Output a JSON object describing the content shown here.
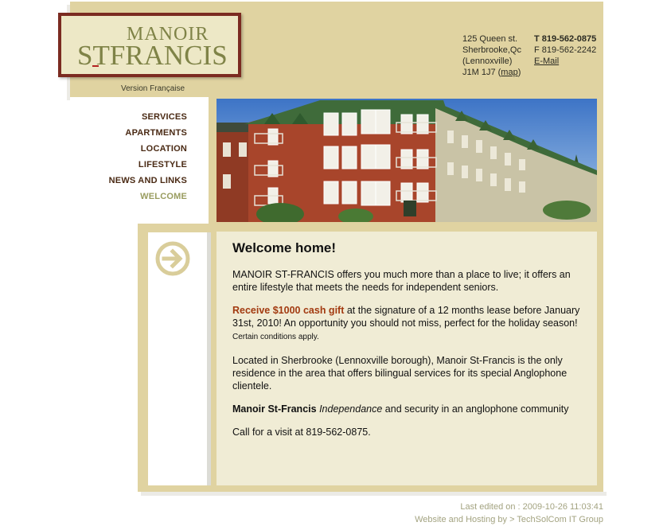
{
  "brand": {
    "logo_line1": "MANOIR",
    "logo_line2": "STFRANCIS",
    "language_link": "Version Française"
  },
  "contact": {
    "address_line1": "125 Queen st.",
    "address_line2": "Sherbrooke,Qc",
    "address_line3": "(Lennoxville)",
    "address_line4_prefix": "J1M 1J7 (",
    "map_link": "map",
    "address_line4_suffix": ")",
    "phone": "T 819-562-0875",
    "fax": "F 819-562-2242",
    "email_link": "E-Mail"
  },
  "nav": {
    "items": [
      {
        "label": "SERVICES"
      },
      {
        "label": "APARTMENTS"
      },
      {
        "label": "LOCATION"
      },
      {
        "label": "LIFESTYLE"
      },
      {
        "label": "NEWS AND LINKS"
      },
      {
        "label": "WELCOME"
      }
    ],
    "active_color": "#999c5f"
  },
  "icons": {
    "side": "arrow-circle-right-icon"
  },
  "content": {
    "title": "Welcome home!",
    "p1": "MANOIR ST-FRANCIS offers you much more than a place to live; it offers an entire lifestyle that meets the needs for independent seniors.",
    "promo_highlight": "Receive $1000 cash gift",
    "promo_rest": " at the signature of a 12 months lease before January 31st, 2010! An opportunity you should not miss, perfect for the holiday season! ",
    "promo_note": "Certain conditions apply.",
    "p3": "Located in Sherbrooke (Lennoxville borough), Manoir St-Francis is the only residence in the area that offers bilingual services for its special Anglophone clientele.",
    "p4_bold": "Manoir St-Francis",
    "p4_italic": "Independance",
    "p4_rest": " and security in an anglophone community",
    "p5": "Call for a visit at 819-562-0875."
  },
  "footer": {
    "last_edited": "Last edited on : 2009-10-26 11:03:41",
    "hosting": "Website and Hosting by > TechSolCom IT Group"
  },
  "colors": {
    "frame": "#e0d3a1",
    "logo_border": "#7b2b21",
    "logo_text": "#7f8347",
    "promo": "#a23a10",
    "nav_text": "#4a2a14",
    "footer_text": "#a3a380"
  }
}
